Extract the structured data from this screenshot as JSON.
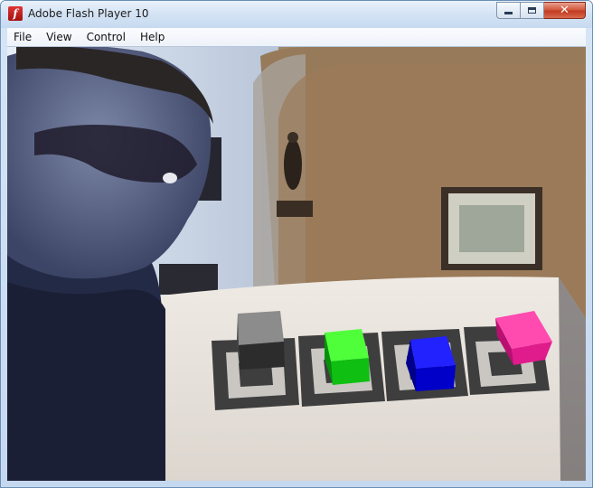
{
  "window": {
    "title": "Adobe Flash Player 10",
    "icon": "flash-player-icon",
    "controls": {
      "minimize": "minimize-icon",
      "maximize": "maximize-icon",
      "close": "close-icon",
      "close_glyph": "✕"
    },
    "icon_glyph": "f"
  },
  "menu": {
    "items": [
      {
        "label": "File"
      },
      {
        "label": "View"
      },
      {
        "label": "Control"
      },
      {
        "label": "Help"
      }
    ]
  },
  "stage": {
    "content": "webcam augmented reality view with markers and cubes",
    "cubes": [
      {
        "color": "gray",
        "top": "#8a8a8a",
        "front": "#2b2b2b",
        "side": "#444444"
      },
      {
        "color": "green",
        "top": "#4fff3a",
        "front": "#0fbf12",
        "side": "#0a8f0d"
      },
      {
        "color": "blue",
        "top": "#2222ff",
        "front": "#0000c8",
        "side": "#00008a"
      },
      {
        "color": "pink",
        "top": "#ff4bb0",
        "front": "#e01b8c",
        "side": "#b80f70"
      }
    ]
  }
}
